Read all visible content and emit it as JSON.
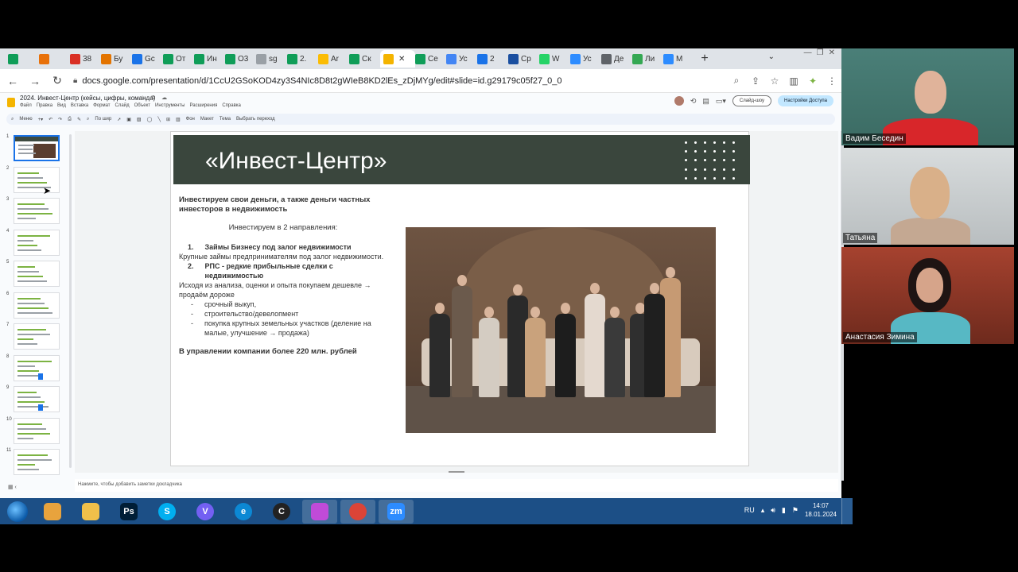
{
  "browser": {
    "tabs": [
      {
        "label": "",
        "icon": "sheets-icon",
        "color": "#0f9d58"
      },
      {
        "label": "",
        "icon": "colorful-icon",
        "color": "#e8710a"
      },
      {
        "label": "38",
        "icon": "gmail-icon",
        "color": "#d93025"
      },
      {
        "label": "Бу",
        "icon": "puzzle-icon",
        "color": "#e37400"
      },
      {
        "label": "Gc",
        "icon": "calendar-icon",
        "color": "#1a73e8"
      },
      {
        "label": "От",
        "icon": "sheets-icon",
        "color": "#0f9d58"
      },
      {
        "label": "Ин",
        "icon": "sheets-icon",
        "color": "#0f9d58"
      },
      {
        "label": "O3",
        "icon": "sheets-icon",
        "color": "#0f9d58"
      },
      {
        "label": "sg",
        "icon": "doc-gray-icon",
        "color": "#9aa0a6"
      },
      {
        "label": "2.",
        "icon": "sheets-icon",
        "color": "#0f9d58"
      },
      {
        "label": "Ar",
        "icon": "drive-icon",
        "color": "#fbbc04"
      },
      {
        "label": "Ск",
        "icon": "sheets-icon",
        "color": "#0f9d58"
      },
      {
        "label": "",
        "icon": "slides-icon",
        "color": "#f4b400",
        "active": true
      },
      {
        "label": "Се",
        "icon": "sheets-icon",
        "color": "#0f9d58"
      },
      {
        "label": "Ус",
        "icon": "docs-icon",
        "color": "#4285f4"
      },
      {
        "label": "2",
        "icon": "circle-blue-icon",
        "color": "#1a73e8"
      },
      {
        "label": "Ср",
        "icon": "24-icon",
        "color": "#1a4fa0"
      },
      {
        "label": "W",
        "icon": "whatsapp-icon",
        "color": "#25d366"
      },
      {
        "label": "Ус",
        "icon": "zoom-icon",
        "color": "#2d8cff"
      },
      {
        "label": "Де",
        "icon": "globe-icon",
        "color": "#5f6368"
      },
      {
        "label": "Ли",
        "icon": "flower-icon",
        "color": "#34a853"
      },
      {
        "label": "M",
        "icon": "zoom-icon",
        "color": "#2d8cff"
      }
    ],
    "url": "docs.google.com/presentation/d/1CcU2GSoKOD4zy3S4NIc8D8t2gWIeB8KD2lEs_zDjMYg/edit#slide=id.g29179c05f27_0_0"
  },
  "app": {
    "doc_title": "2024. Инвест-Центр (кейсы, цифры, команда)",
    "menus": [
      "Файл",
      "Правка",
      "Вид",
      "Вставка",
      "Формат",
      "Слайд",
      "Объект",
      "Инструменты",
      "Расширения",
      "Справка"
    ],
    "slideshow_label": "Слайд-шоу",
    "access_label": "Настройки Доступа",
    "toolbar": {
      "menu": "Меню",
      "zoom": "По шир",
      "bg": "Фон",
      "layout": "Макет",
      "theme": "Тема",
      "transition": "Выбрать переход"
    },
    "slide_numbers": [
      "1",
      "2",
      "3",
      "4",
      "5",
      "6",
      "7",
      "8",
      "9",
      "10",
      "11"
    ],
    "notes_placeholder": "Нажмите, чтобы добавить заметки докладчика"
  },
  "slide": {
    "title": "«Инвест-Центр»",
    "lead": "Инвестируем свои деньги, а также деньги частных инвесторов в недвижимость",
    "directions": "Инвестируем в 2 направления:",
    "item1_num": "1.",
    "item1_title": "Займы Бизнесу под залог недвижимости",
    "item1_text": "Крупные займы предпринимателям под залог недвижимости.",
    "item2_num": "2.",
    "item2_title": "РПС - редкие прибыльные сделки с недвижимостью",
    "item2_text": "Исходя из анализа, оценки и опыта покупаем дешевле → продаём дороже",
    "bullets": [
      "срочный выкуп,",
      "строительство/девелопмент",
      "покупка крупных земельных участков (деление на малые, улучшение → продажа)"
    ],
    "final": "В управлении компании более 220 млн. рублей"
  },
  "taskbar": {
    "lang": "RU",
    "time": "14:07",
    "date": "18.01.2024",
    "apps": [
      {
        "name": "paint-icon",
        "color": "#e8a33d",
        "glyph": ""
      },
      {
        "name": "explorer-icon",
        "color": "#f0c04a",
        "glyph": ""
      },
      {
        "name": "photoshop-icon",
        "color": "#001e36",
        "glyph": "Ps"
      },
      {
        "name": "skype-icon",
        "color": "#00aff0",
        "glyph": "S"
      },
      {
        "name": "viber-icon",
        "color": "#7360f2",
        "glyph": "V"
      },
      {
        "name": "edge-icon",
        "color": "#0c88d4",
        "glyph": "e"
      },
      {
        "name": "c-app-icon",
        "color": "#222222",
        "glyph": "C"
      },
      {
        "name": "prism-icon",
        "color": "#c04bd8",
        "glyph": ""
      },
      {
        "name": "chrome-icon",
        "color": "#db4437",
        "glyph": ""
      },
      {
        "name": "zoom-app-icon",
        "color": "#2d8cff",
        "glyph": "zm"
      }
    ]
  },
  "participants": [
    {
      "name": "Вадим Беседин"
    },
    {
      "name": "Татьяна"
    },
    {
      "name": "Анастасия Зимина"
    }
  ]
}
